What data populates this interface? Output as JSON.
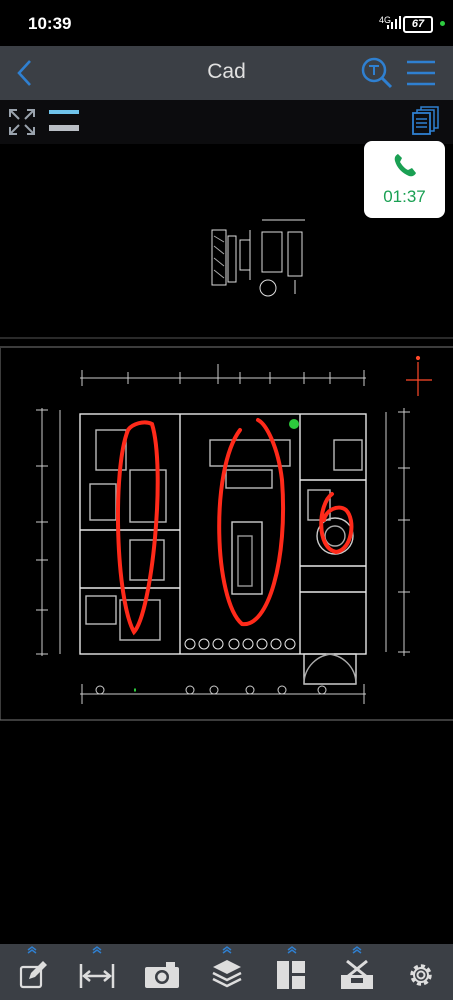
{
  "status_bar": {
    "time": "10:39",
    "network": "4G",
    "battery": "67"
  },
  "header": {
    "title": "Cad"
  },
  "call": {
    "timer": "01:37"
  },
  "colors": {
    "accent": "#2f80d1",
    "call_green": "#1aa053",
    "annotation_red": "#ff2a1a",
    "bar_bg": "#3b3f45"
  },
  "icons": {
    "header": [
      "back-icon",
      "text-search-icon",
      "menu-icon"
    ],
    "view": [
      "fit-screen-icon",
      "layer-lines-icon",
      "documents-icon"
    ],
    "bottom": [
      "edit-icon",
      "measure-icon",
      "camera-icon",
      "layers-icon",
      "layout-icon",
      "tools-icon",
      "settings-icon"
    ]
  }
}
